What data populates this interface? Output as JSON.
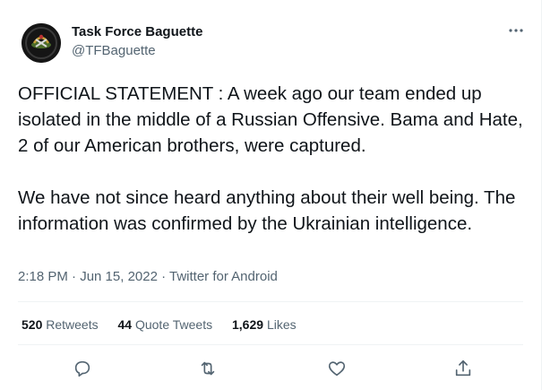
{
  "author": {
    "name": "Task Force Baguette",
    "handle": "@TFBaguette"
  },
  "more_icon": "more-horizontal-icon",
  "tweet_text": "OFFICIAL STATEMENT : A week ago our team ended up isolated in the middle of a Russian Offensive. Bama and Hate, 2 of our American brothers, were captured.\n\nWe have not since heard anything about their well being. The information was confirmed by the Ukrainian intelligence.",
  "meta": {
    "time": "2:18 PM",
    "date": "Jun 15, 2022",
    "source": "Twitter for Android",
    "line": "2:18 PM · Jun 15, 2022 · Twitter for Android"
  },
  "stats": {
    "retweets_count": "520",
    "retweets_label": "Retweets",
    "quotes_count": "44",
    "quotes_label": "Quote Tweets",
    "likes_count": "1,629",
    "likes_label": "Likes"
  },
  "actions": [
    "reply-icon",
    "retweet-icon",
    "like-icon",
    "share-icon"
  ],
  "colors": {
    "text": "#0f1419",
    "muted": "#536471",
    "divider": "#eff3f4"
  }
}
